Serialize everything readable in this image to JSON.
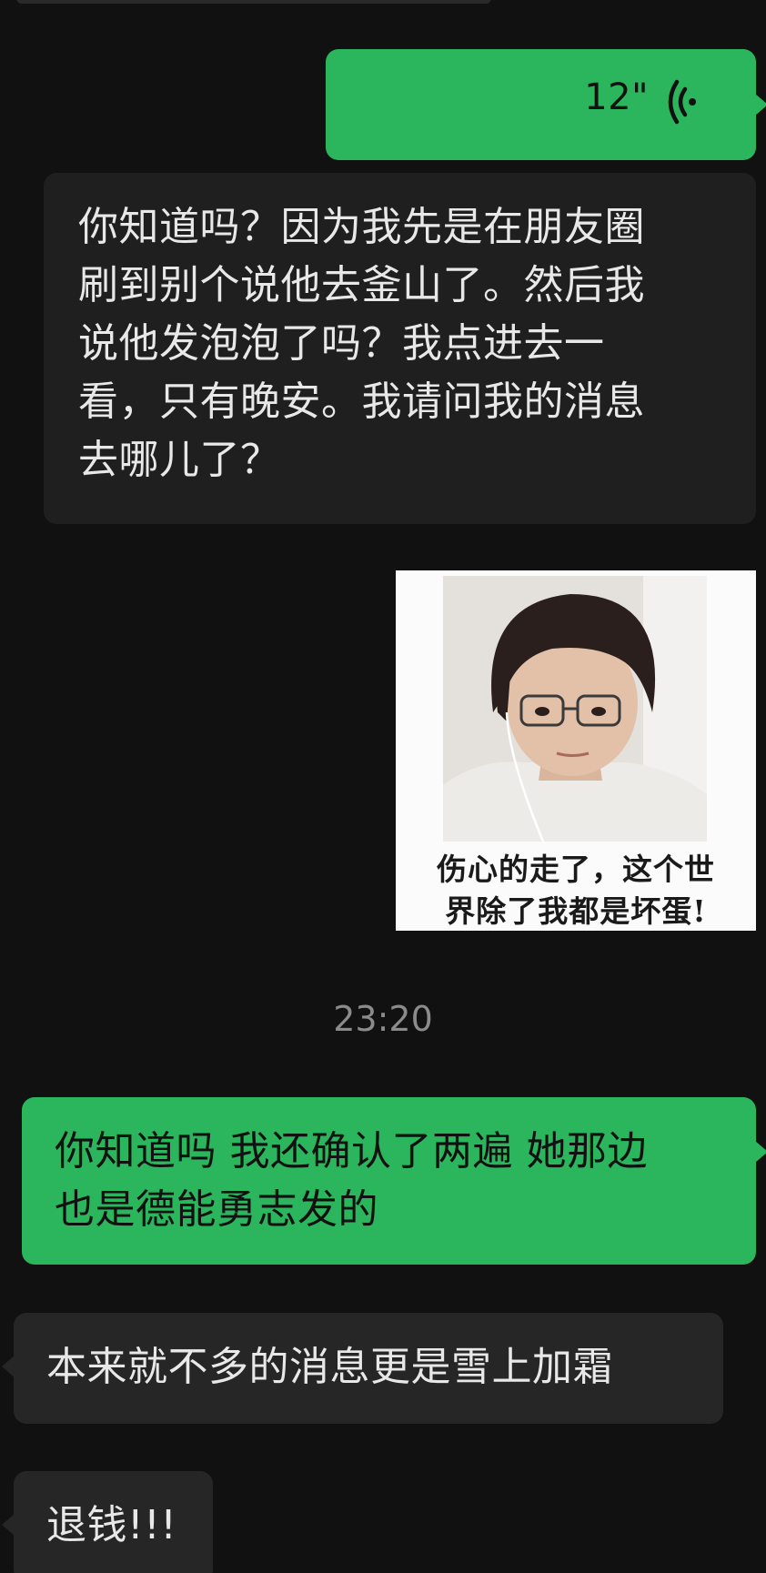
{
  "messages": {
    "voice": {
      "duration": "12\""
    },
    "incoming_long": {
      "lines": [
        "你知道吗？因为我先是在朋友圈",
        "刷到别个说他去釜山了。然后我",
        "说他发泡泡了吗？我点进去一",
        "看，只有晚安。我请问我的消息",
        "去哪儿了？"
      ]
    },
    "sticker": {
      "caption_line1": "伤心的走了，这个世",
      "caption_line2": "界除了我都是坏蛋!"
    },
    "timestamp": "23:20",
    "outgoing_text": {
      "lines": [
        "你知道吗 我还确认了两遍 她那边",
        "也是德能勇志发的"
      ]
    },
    "incoming_snow": "本来就不多的消息更是雪上加霜",
    "incoming_refund": "退钱!!!"
  },
  "colors": {
    "background": "#111111",
    "outgoing_bubble": "#2bb55c",
    "incoming_bubble": "#262626",
    "timestamp_text": "#8b8b8b"
  },
  "icons": {
    "voice": "voice-wave-icon"
  }
}
